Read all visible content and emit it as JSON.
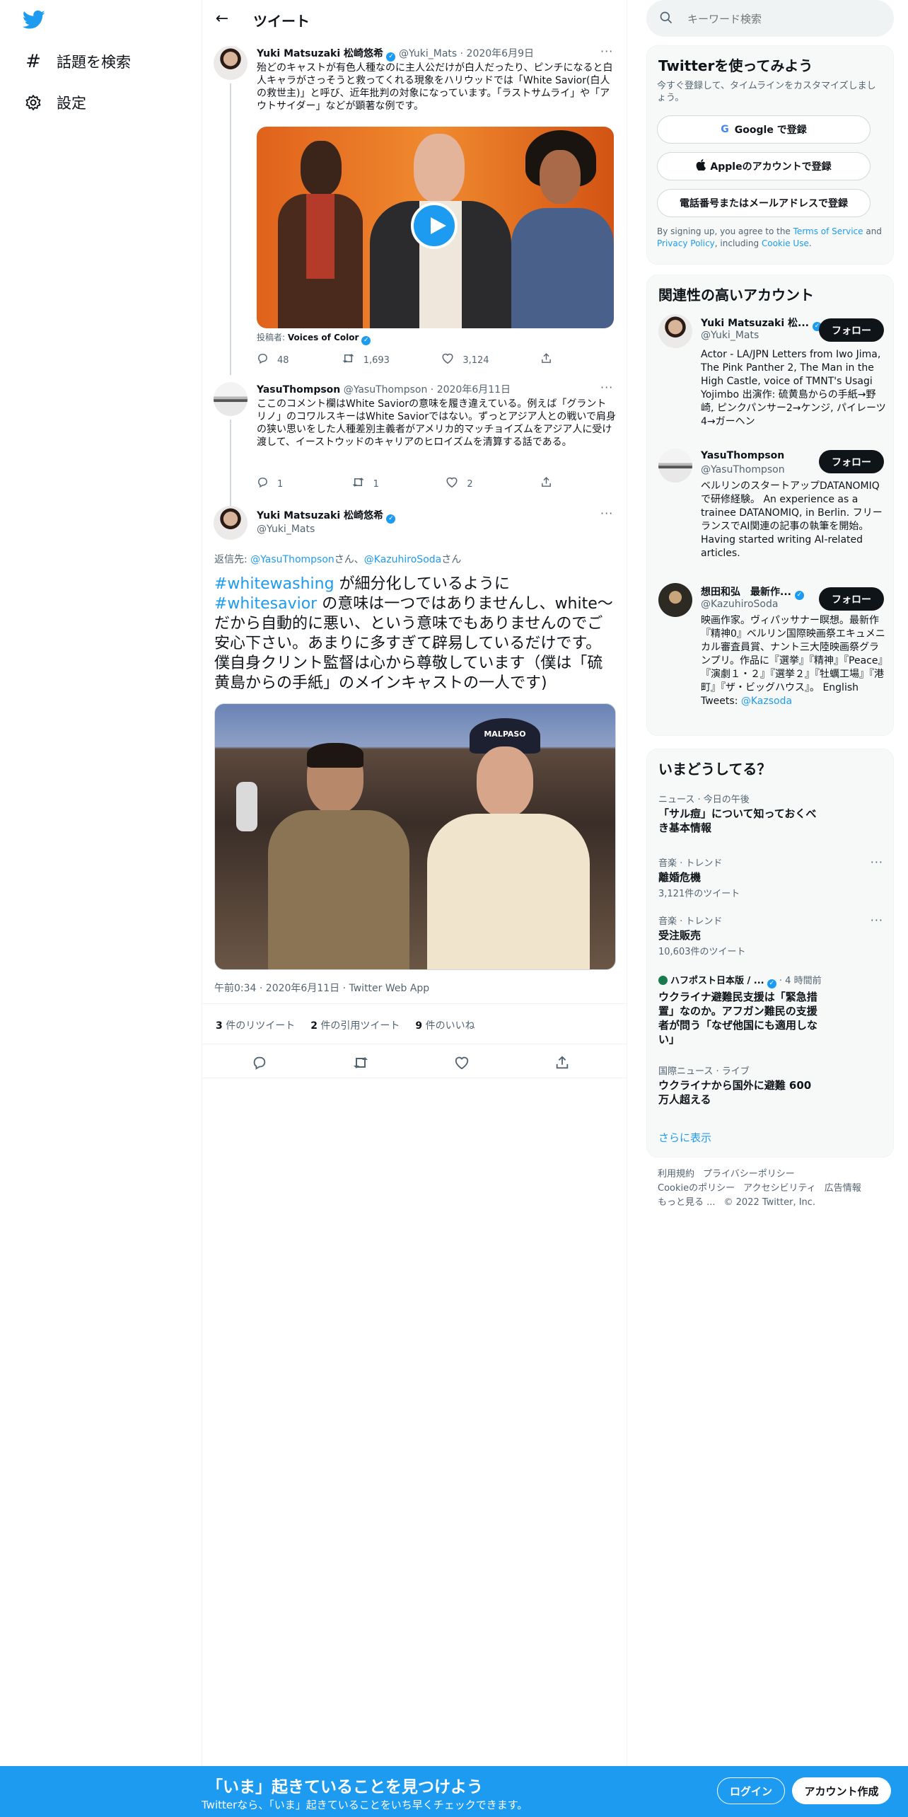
{
  "nav": {
    "explore_label": "話題を検索",
    "settings_label": "設定"
  },
  "header": {
    "title": "ツイート"
  },
  "tweet1": {
    "name": "Yuki Matsuzaki 松崎悠希",
    "handle": "@Yuki_Mats",
    "date": "· 2020年6月9日",
    "text": "殆どのキャストが有色人種なのに主人公だけが白人だったり、ピンチになると白人キャラがさっそうと救ってくれる現象をハリウッドでは「White Savior(白人の救世主)」と呼び、近年批判の対象になっています。「ラストサムライ」や「アウトサイダー」などが顕著な例です。",
    "poster_label": "投稿者:",
    "poster_name": "Voices of Color",
    "replies": "48",
    "retweets": "1,693",
    "likes": "3,124"
  },
  "tweet2": {
    "name": "YasuThompson",
    "handle": "@YasuThompson",
    "date": "· 2020年6月11日",
    "text": "ここのコメント欄はWhite Saviorの意味を履き違えている。例えば「グラントリノ」のコワルスキーはWhite Saviorではない。ずっとアジア人との戦いで肩身の狭い思いをした人種差別主義者がアメリカ的マッチョイズムをアジア人に受け渡して、イーストウッドのキャリアのヒロイズムを清算する話である。",
    "replies": "1",
    "retweets": "1",
    "likes": "2"
  },
  "main_tweet": {
    "name": "Yuki Matsuzaki 松崎悠希",
    "handle": "@Yuki_Mats",
    "reply_to_label": "返信先:",
    "reply_to_1": "@YasuThompson",
    "reply_to_sep": "さん、",
    "reply_to_2": "@KazuhiroSoda",
    "reply_to_suffix": "さん",
    "hashtag1": "#whitewashing",
    "text_mid": " が細分化しているように ",
    "hashtag2": "#whitesavior",
    "text_rest": " の意味は一つではありませんし、white～だから自動的に悪い、という意味でもありませんのでご安心下さい。あまりに多すぎて辟易しているだけです。僕自身クリント監督は心から尊敬しています（僕は「硫黄島からの手紙」のメインキャストの一人です)",
    "photo_cap_text": "MALPASO",
    "timestamp": "午前0:34 · 2020年6月11日 · Twitter Web App",
    "retweets_count": "3",
    "retweets_label": "件のリツイート",
    "quotes_count": "2",
    "quotes_label": "件の引用ツイート",
    "likes_count": "9",
    "likes_label": "件のいいね"
  },
  "search": {
    "placeholder": "キーワード検索"
  },
  "signup_panel": {
    "title": "Twitterを使ってみよう",
    "subtitle": "今すぐ登録して、タイムラインをカスタマイズしましょう。",
    "google_btn": "Google で登録",
    "apple_btn": "Appleのアカウントで登録",
    "phone_btn": "電話番号またはメールアドレスで登録",
    "legal_1": "By signing up, you agree to the ",
    "tos": "Terms of Service",
    "legal_2": " and ",
    "privacy": "Privacy Policy",
    "legal_3": ", including ",
    "cookie": "Cookie Use",
    "legal_4": "."
  },
  "related": {
    "title": "関連性の高いアカウント",
    "follow_label": "フォロー",
    "accounts": [
      {
        "name": "Yuki Matsuzaki 松...",
        "handle": "@Yuki_Mats",
        "bio": "Actor - LA/JPN Letters from Iwo Jima, The Pink Panther 2, The Man in the High Castle, voice of TMNT's Usagi Yojimbo 出演作: 硫黄島からの手紙→野崎, ピンクパンサー2→ケンジ, パイレーツ4→ガーヘン"
      },
      {
        "name": "YasuThompson",
        "handle": "@YasuThompson",
        "bio": "ベルリンのスタートアップDATANOMIQで研修経験。 An experience as a trainee DATANOMIQ, in Berlin. フリーランスでAI関連の記事の執筆を開始。 Having started writing AI-related articles."
      },
      {
        "name": "想田和弘　最新作...",
        "handle": "@KazuhiroSoda",
        "bio": "映画作家。ヴィパッサナー瞑想。最新作『精神0』ベルリン国際映画祭エキュメニカル審査員賞、ナント三大陸映画祭グランプリ。作品に『選挙』『精神』『Peace』『演劇１・２』『選挙２』『牡蠣工場』『港町』『ザ・ビッグハウス』。 English Tweets: ",
        "bio_link": "@Kazsoda"
      }
    ]
  },
  "trends": {
    "title": "いまどうしてる？",
    "items": [
      {
        "meta": "ニュース · 今日の午後",
        "title": "「サル痘」について知っておくべき基本情報",
        "count": ""
      },
      {
        "meta": "音楽 · トレンド",
        "title": "離婚危機",
        "count": "3,121件のツイート"
      },
      {
        "meta": "音楽 · トレンド",
        "title": "受注販売",
        "count": "10,603件のツイート"
      },
      {
        "meta": "ハフポスト日本版 / ...",
        "meta_time": " · 4 時間前",
        "title": "ウクライナ避難民支援は「緊急措置」なのか。アフガン難民の支援者が問う「なぜ他国にも適用しない」",
        "count": ""
      },
      {
        "meta": "国際ニュース · ライブ",
        "title": "ウクライナから国外に避難 600万人超える",
        "count": ""
      }
    ],
    "show_more": "さらに表示"
  },
  "footer": {
    "terms": "利用規約",
    "privacy": "プライバシーポリシー",
    "cookie": "Cookieのポリシー",
    "accessibility": "アクセシビリティ",
    "ads": "広告情報",
    "more": "もっと見る ...",
    "copyright": "© 2022 Twitter, Inc."
  },
  "bottom_bar": {
    "title": "「いま」起きていることを見つけよう",
    "subtitle": "Twitterなら、「いま」起きていることをいち早くチェックできます。",
    "login": "ログイン",
    "signup": "アカウント作成"
  },
  "colors": {
    "brand_blue": "#1d9bf0",
    "text_primary": "#0f1419",
    "text_secondary": "#536471",
    "panel_bg": "#f7f9f9"
  },
  "icons": [
    "twitter-logo-icon",
    "hashtag-icon",
    "gear-icon",
    "back-arrow-icon",
    "search-icon",
    "verified-icon",
    "reply-icon",
    "retweet-icon",
    "like-icon",
    "share-icon",
    "more-icon",
    "play-icon",
    "google-icon",
    "apple-icon"
  ]
}
